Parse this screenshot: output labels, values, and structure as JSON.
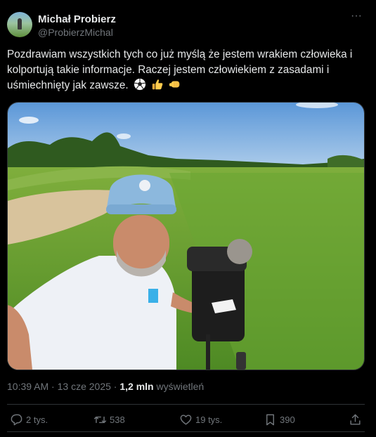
{
  "author": {
    "name": "Michał Probierz",
    "handle": "@ProbierzMichal"
  },
  "post": {
    "text": "Pozdrawiam wszystkich tych co już myślą że jestem wrakiem człowieka i kolportują takie informacje. Raczej jestem człowiekiem z zasadami i uśmiechnięty jak zawsze.",
    "emojis": [
      "soccer-ball",
      "thumbs-up",
      "left-facing-fist"
    ]
  },
  "meta": {
    "time": "10:39 AM",
    "separator": " · ",
    "date": "13 cze 2025",
    "views_count": "1,2 mln",
    "views_label": "wyświetleń"
  },
  "actions": {
    "replies": "2 tys.",
    "reposts": "538",
    "likes": "19 tys.",
    "bookmarks": "390"
  },
  "colors": {
    "background": "#000000",
    "text": "#e7e9ea",
    "secondary": "#71767b",
    "border": "#2f3336"
  }
}
